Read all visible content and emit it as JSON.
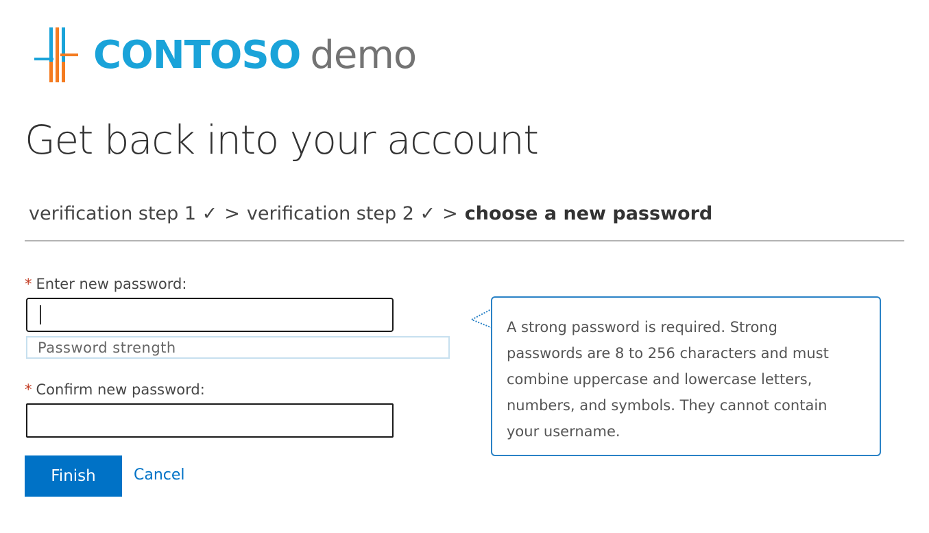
{
  "logo": {
    "brand": "CONTOSO",
    "suffix": "demo",
    "colors": {
      "brand": "#1aa3d9",
      "suffix": "#737373",
      "mark_orange": "#f47b20",
      "mark_blue": "#1aa3d9"
    }
  },
  "page_title": "Get back into your account",
  "breadcrumb": {
    "step1": "verification step 1 ✓",
    "step2": "verification step 2 ✓",
    "separator": ">",
    "current": "choose a new password"
  },
  "form": {
    "required_marker": "*",
    "new_password": {
      "label": "Enter new password:",
      "value": ""
    },
    "strength_label": "Password strength",
    "confirm_password": {
      "label": "Confirm new password:",
      "value": ""
    }
  },
  "buttons": {
    "finish_label": "Finish",
    "cancel_label": "Cancel"
  },
  "help": {
    "text": "A strong password is required. Strong passwords are 8 to 256 characters and must combine uppercase and lowercase letters, numbers, and symbols. They cannot contain your username."
  },
  "colors": {
    "accent": "#0072c6",
    "required": "#c23b22",
    "callout_border": "#2a82c6",
    "strength_border": "#c7e0ef"
  }
}
